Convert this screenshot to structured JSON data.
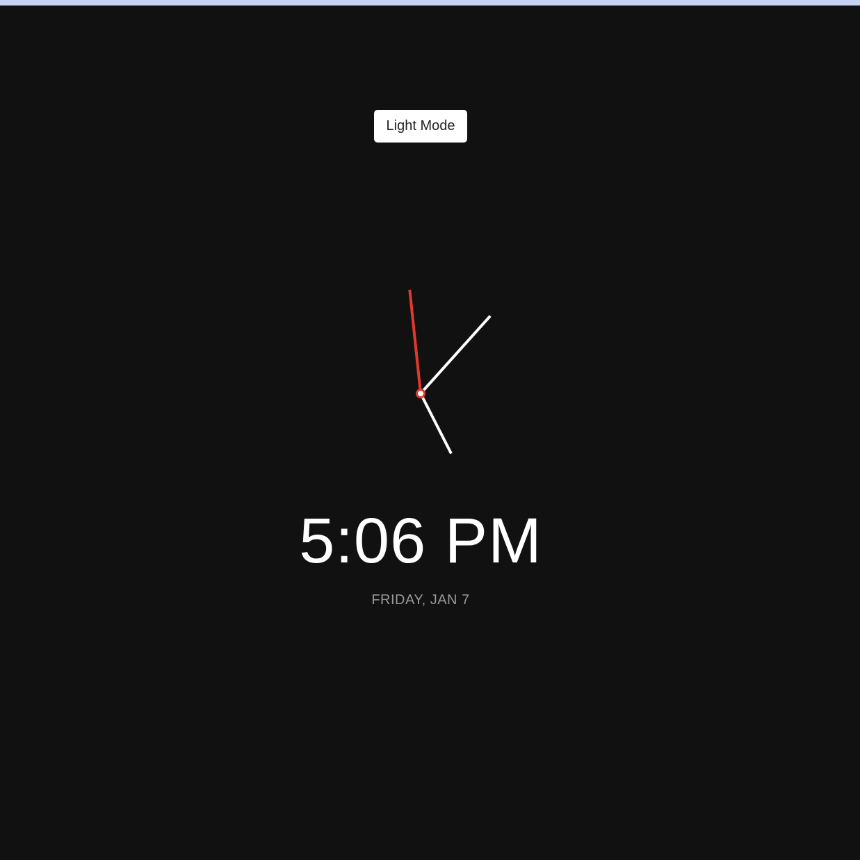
{
  "toggle": {
    "label": "Light Mode"
  },
  "clock": {
    "hour": 5,
    "minute": 6,
    "second": 59,
    "hand_color": "#ffffff",
    "second_hand_color": "#e03a2e",
    "background": "#111111"
  },
  "time_text": "5:06 PM",
  "date_text": "FRIDAY, JAN 7"
}
